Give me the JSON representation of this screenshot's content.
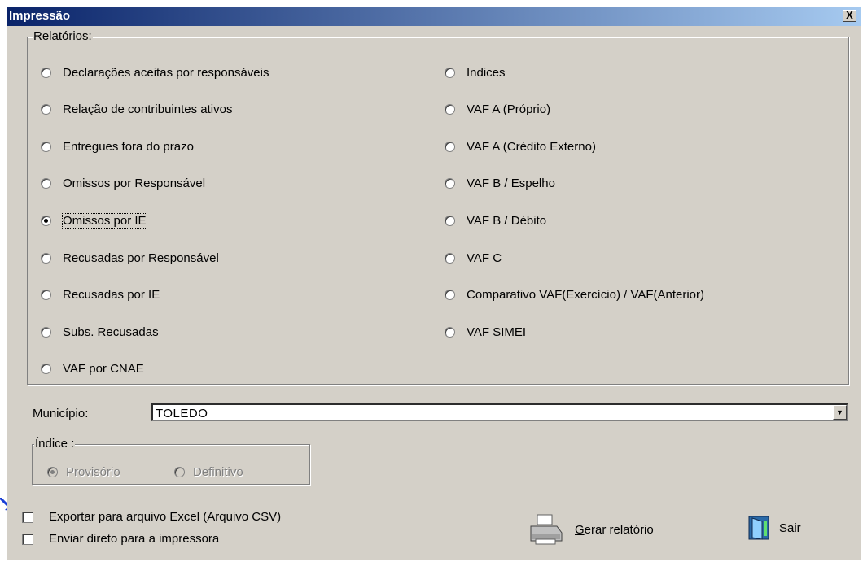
{
  "window": {
    "title": "Impressão",
    "close_label": "X"
  },
  "relatorios": {
    "legend": "Relatórios:",
    "left": [
      {
        "label": "Declarações aceitas por responsáveis",
        "checked": false
      },
      {
        "label": "Relação de contribuintes ativos",
        "checked": false
      },
      {
        "label": "Entregues fora do prazo",
        "checked": false
      },
      {
        "label": "Omissos por Responsável",
        "checked": false
      },
      {
        "label": "Omissos por IE",
        "checked": true
      },
      {
        "label": "Recusadas por Responsável",
        "checked": false
      },
      {
        "label": "Recusadas por IE",
        "checked": false
      },
      {
        "label": "Subs. Recusadas",
        "checked": false
      },
      {
        "label": "VAF por CNAE",
        "checked": false
      }
    ],
    "right": [
      {
        "label": "Indices",
        "checked": false
      },
      {
        "label": "VAF A (Próprio)",
        "checked": false
      },
      {
        "label": "VAF A (Crédito Externo)",
        "checked": false
      },
      {
        "label": "VAF B  / Espelho",
        "checked": false
      },
      {
        "label": "VAF B / Débito",
        "checked": false
      },
      {
        "label": "VAF C",
        "checked": false
      },
      {
        "label": "Comparativo VAF(Exercício) / VAF(Anterior)",
        "checked": false
      },
      {
        "label": "VAF SIMEI",
        "checked": false
      }
    ]
  },
  "municipio": {
    "label": "Município:",
    "value": "TOLEDO"
  },
  "indice": {
    "legend": "Índice :",
    "options": [
      {
        "label": "Provisório",
        "checked": true
      },
      {
        "label": "Definitivo",
        "checked": false
      }
    ]
  },
  "options": {
    "export_csv": "Exportar para arquivo Excel (Arquivo CSV)",
    "send_printer": "Enviar direto para a impressora"
  },
  "buttons": {
    "gerar_first": "G",
    "gerar_rest": "erar relatório",
    "sair": "Sair"
  },
  "colors": {
    "titlebar_start": "#0a246a",
    "titlebar_end": "#a6caf0",
    "face": "#d4d0c8",
    "arrow": "#1a3fd6"
  }
}
